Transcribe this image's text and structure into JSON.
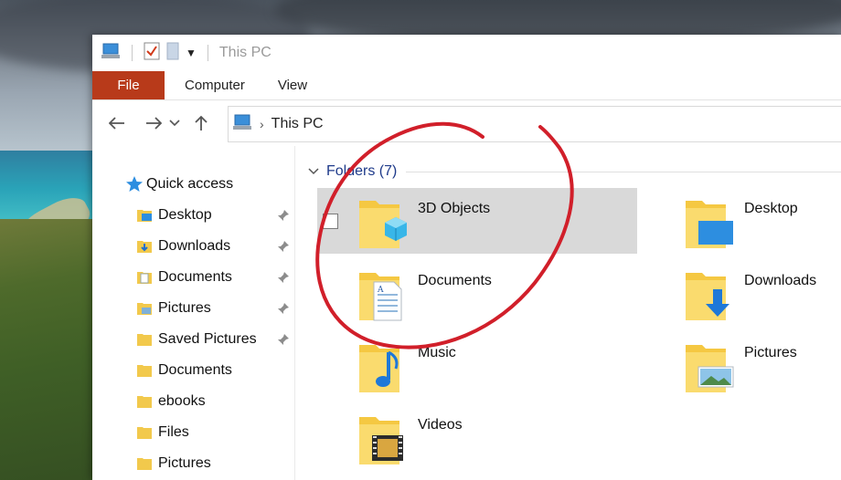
{
  "window": {
    "title": "This PC",
    "icons": {
      "app": "computer-icon",
      "properties": "checklist-icon",
      "new_folder": "folder-icon",
      "customize": "caret-down-icon"
    }
  },
  "ribbon": {
    "tabs": [
      {
        "label": "File",
        "active": true
      },
      {
        "label": "Computer",
        "active": false
      },
      {
        "label": "View",
        "active": false
      }
    ],
    "file_color": "#b83a1a"
  },
  "address": {
    "path": "This PC",
    "nav_icons": [
      "back-arrow-icon",
      "forward-arrow-icon",
      "recent-chevron-icon",
      "up-arrow-icon"
    ]
  },
  "nav_pane": {
    "quick_access_label": "Quick access",
    "items": [
      {
        "label": "Desktop",
        "pinned": true,
        "icon": "desktop-folder-icon"
      },
      {
        "label": "Downloads",
        "pinned": true,
        "icon": "downloads-folder-icon"
      },
      {
        "label": "Documents",
        "pinned": true,
        "icon": "documents-folder-icon"
      },
      {
        "label": "Pictures",
        "pinned": true,
        "icon": "pictures-folder-icon"
      },
      {
        "label": "Saved Pictures",
        "pinned": true,
        "icon": "folder-icon"
      },
      {
        "label": "Documents",
        "pinned": false,
        "icon": "folder-icon"
      },
      {
        "label": "ebooks",
        "pinned": false,
        "icon": "folder-icon"
      },
      {
        "label": "Files",
        "pinned": false,
        "icon": "folder-icon"
      },
      {
        "label": "Pictures",
        "pinned": false,
        "icon": "folder-icon"
      }
    ]
  },
  "content": {
    "group_label": "Folders (7)",
    "folders": [
      {
        "name": "3D Objects",
        "icon": "3d-objects-folder-icon",
        "selected": true
      },
      {
        "name": "Desktop",
        "icon": "desktop-folder-icon",
        "selected": false
      },
      {
        "name": "Documents",
        "icon": "documents-folder-icon",
        "selected": false
      },
      {
        "name": "Downloads",
        "icon": "downloads-folder-icon",
        "selected": false
      },
      {
        "name": "Music",
        "icon": "music-folder-icon",
        "selected": false
      },
      {
        "name": "Pictures",
        "icon": "pictures-folder-icon",
        "selected": false
      },
      {
        "name": "Videos",
        "icon": "videos-folder-icon",
        "selected": false
      }
    ]
  },
  "colors": {
    "accent": "#1e3a8a",
    "selection": "#d9d9d9",
    "annotation": "#d11f2a"
  }
}
